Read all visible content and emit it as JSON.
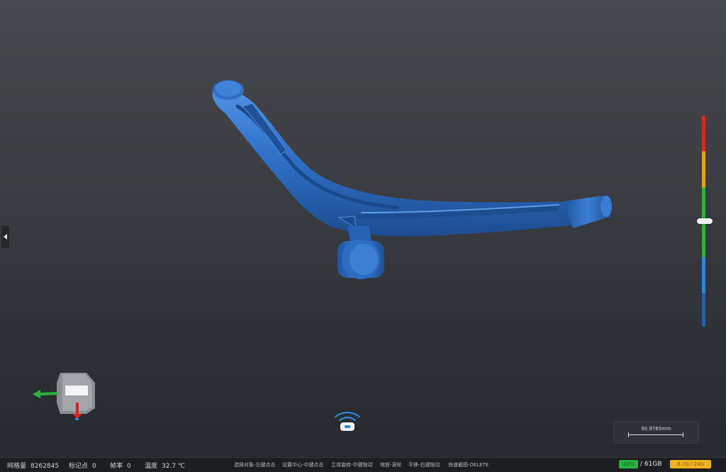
{
  "status_bar": {
    "mesh_label": "网格量",
    "mesh_value": "8262845",
    "markers_label": "标记点",
    "markers_value": "0",
    "frames_label": "帧率",
    "frames_value": "0",
    "temp_label": "温度",
    "temp_value": "32.7 ℃",
    "hints": [
      "选择对象-左键点击",
      "设置中心-中键点击",
      "立体旋转-中键拖动",
      "缩放-滚轮",
      "平移-右键拖动",
      "快速截图-DELETE"
    ],
    "memory_badge": "43%",
    "memory_total": "/ 61GB",
    "gpu_badge": "8.7G / 24G"
  },
  "scale_indicator": {
    "value_text": "90.9765mm"
  },
  "color_scale": {
    "handle_level": 0.5,
    "colors": [
      "#d42a1f",
      "#e3a51e",
      "#2db23d",
      "#2f86d8",
      "#2a5ea7"
    ]
  },
  "model": {
    "color": "#2c6cc0",
    "highlight": "#4e8fdf",
    "shadow": "#1d4f93"
  },
  "axis_widget": {
    "x_color": "#2db23d",
    "y_color": "#e0231a"
  },
  "icons": {
    "scanner": "scanner-wifi-icon",
    "collapse": "collapse-left-arrow-icon"
  }
}
